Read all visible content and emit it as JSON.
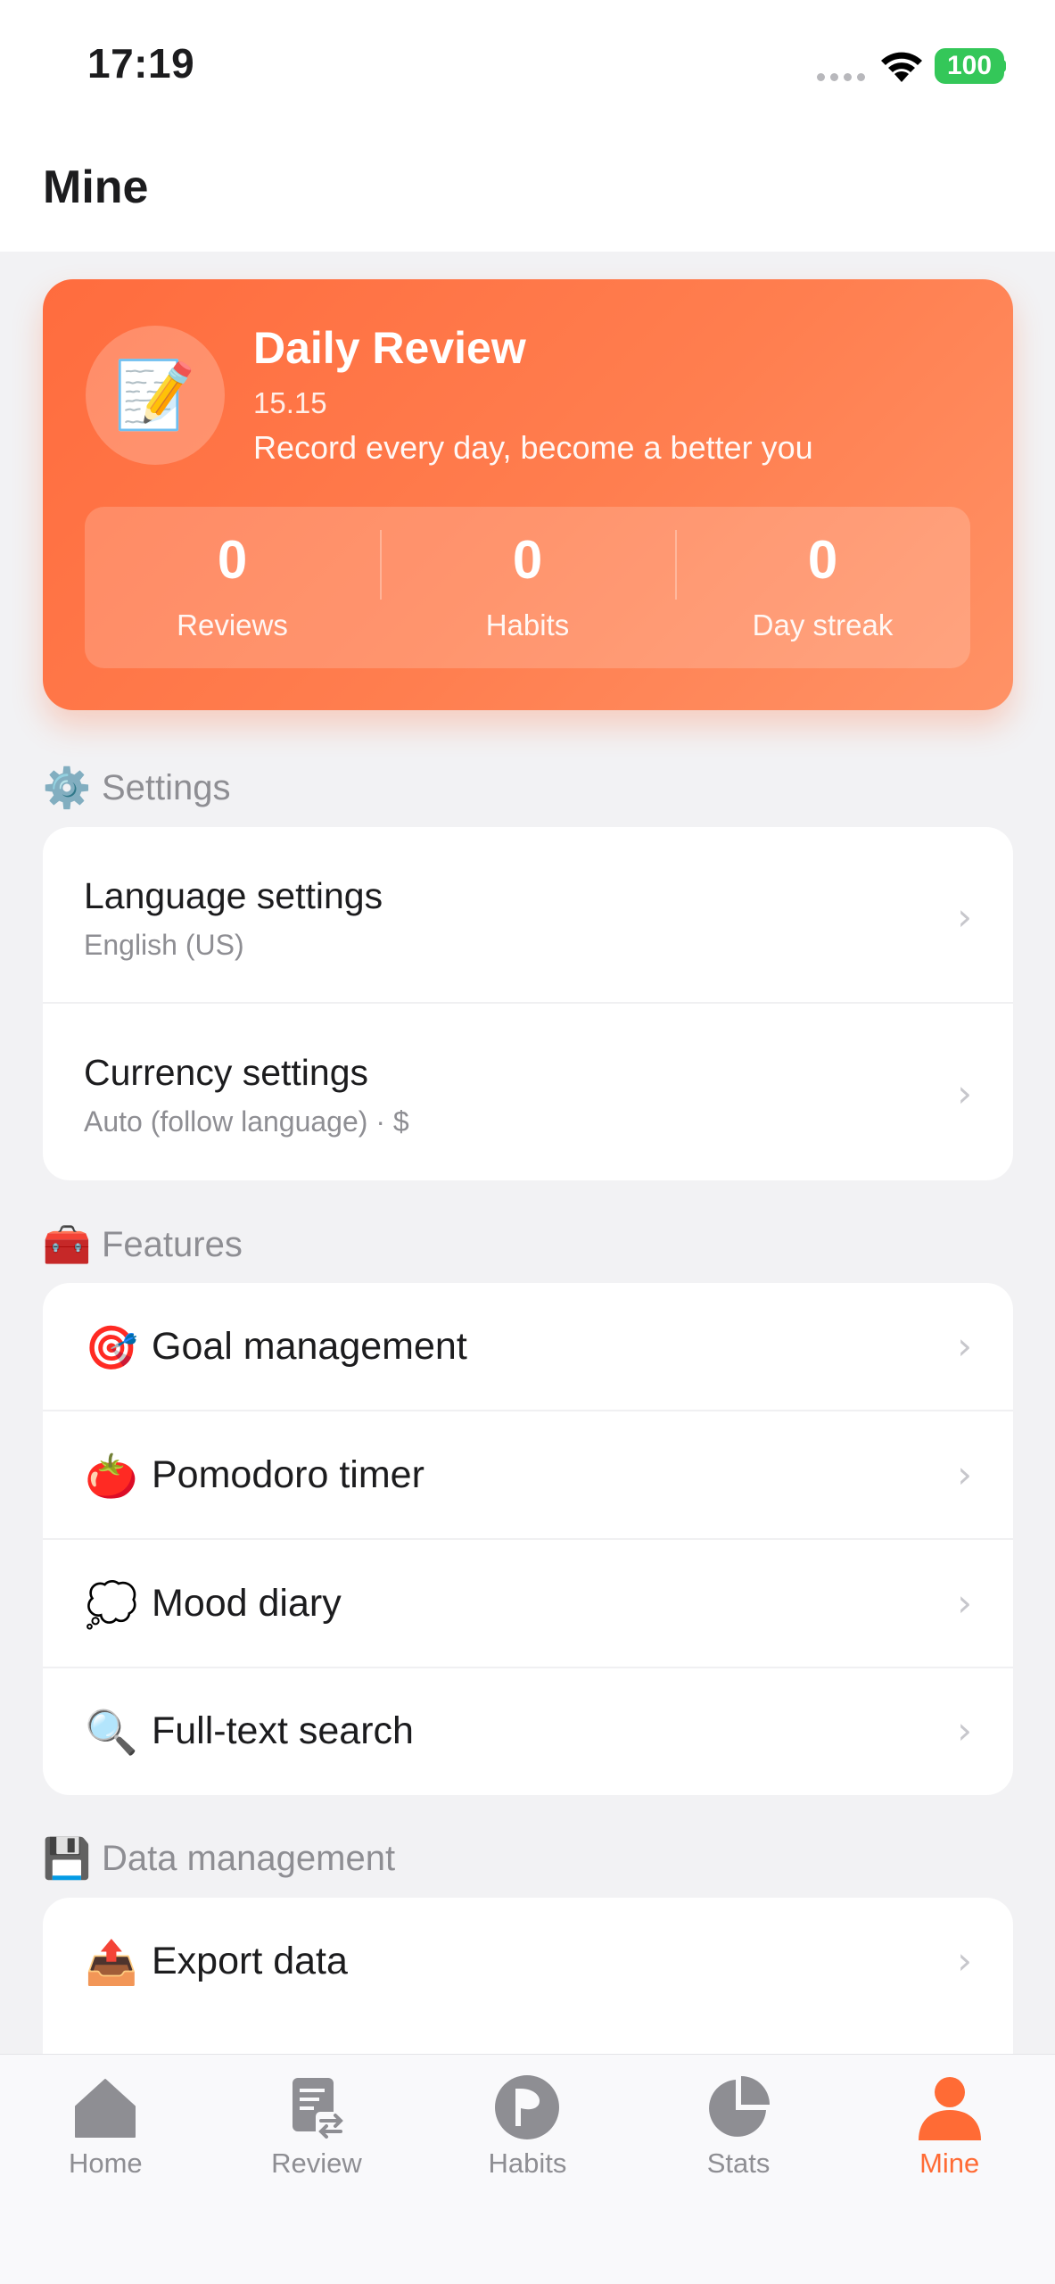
{
  "status": {
    "time": "17:19",
    "battery": "100"
  },
  "header": {
    "title": "Mine"
  },
  "hero": {
    "title": "Daily Review",
    "value": "15.15",
    "tagline": "Record every day, become a better you",
    "avatar_icon": "memo-icon",
    "stats": [
      {
        "value": "0",
        "label": "Reviews"
      },
      {
        "value": "0",
        "label": "Habits"
      },
      {
        "value": "0",
        "label": "Day streak"
      }
    ]
  },
  "sections": {
    "settings": {
      "label": "Settings",
      "icon": "gear-icon",
      "items": [
        {
          "title": "Language settings",
          "subtitle": "English (US)"
        },
        {
          "title": "Currency settings",
          "subtitle": "Auto (follow language) · $"
        }
      ]
    },
    "features": {
      "label": "Features",
      "icon": "toolbox-icon",
      "items": [
        {
          "icon": "target-icon",
          "label": "Goal management"
        },
        {
          "icon": "tomato-icon",
          "label": "Pomodoro timer"
        },
        {
          "icon": "thought-bubble-icon",
          "label": "Mood diary"
        },
        {
          "icon": "magnifier-icon",
          "label": "Full-text search"
        }
      ]
    },
    "data": {
      "label": "Data management",
      "icon": "floppy-disk-icon",
      "items": [
        {
          "icon": "outbox-tray-icon",
          "label": "Export data"
        }
      ]
    }
  },
  "tabbar": {
    "active": "Mine",
    "accent": "#ff6b35",
    "tabs": [
      {
        "label": "Home",
        "icon": "home-icon"
      },
      {
        "label": "Review",
        "icon": "review-document-icon"
      },
      {
        "label": "Habits",
        "icon": "habits-flag-icon"
      },
      {
        "label": "Stats",
        "icon": "pie-chart-icon"
      },
      {
        "label": "Mine",
        "icon": "person-icon"
      }
    ]
  }
}
